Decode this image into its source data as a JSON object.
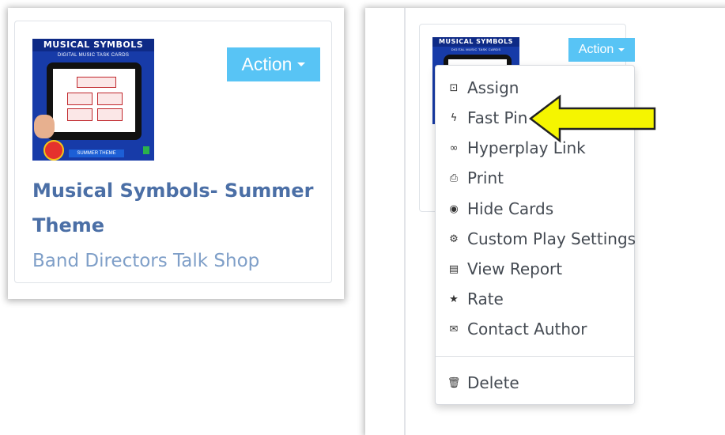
{
  "left_card": {
    "thumbnail": {
      "title": "MUSICAL SYMBOLS",
      "subtitle": "DIGITAL MUSIC TASK CARDS",
      "theme_label": "SUMMER THEME"
    },
    "action_label": "Action",
    "title": "Musical Symbols- Summer Theme",
    "author": "Band Directors Talk Shop"
  },
  "right_card": {
    "thumbnail": {
      "title": "MUSICAL SYMBOLS",
      "subtitle": "DIGITAL MUSIC TASK CARDS"
    },
    "action_label": "Action"
  },
  "dropdown": {
    "items": [
      {
        "label": "Assign",
        "icon": "assign-icon"
      },
      {
        "label": "Fast Pin",
        "icon": "bolt-icon"
      },
      {
        "label": "Hyperplay Link",
        "icon": "link-icon"
      },
      {
        "label": "Print",
        "icon": "print-icon"
      },
      {
        "label": "Hide Cards",
        "icon": "eye-icon"
      },
      {
        "label": "Custom Play Settings",
        "icon": "gear-icon"
      },
      {
        "label": "View Report",
        "icon": "clipboard-icon"
      },
      {
        "label": "Rate",
        "icon": "star-icon"
      },
      {
        "label": "Contact Author",
        "icon": "envelope-icon"
      }
    ],
    "delete_item": {
      "label": "Delete",
      "icon": "trash-icon"
    }
  },
  "colors": {
    "action_button": "#58c4f5",
    "title_text": "#4b6fa6",
    "author_text": "#7f9fc8",
    "highlight_arrow": "#f5f500"
  }
}
